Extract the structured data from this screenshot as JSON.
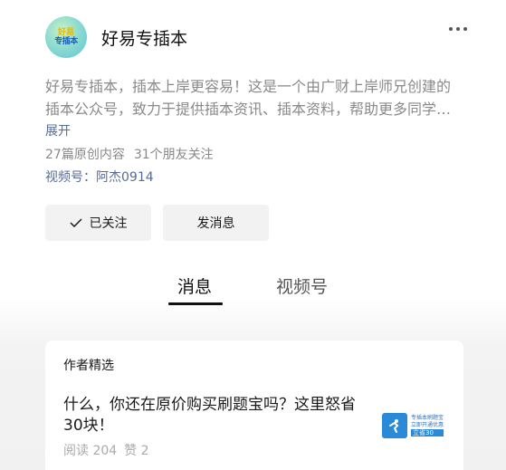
{
  "account": {
    "avatar_line1": "好易",
    "avatar_line2": "专插本",
    "name": "好易专插本",
    "description": "好易专插本，插本上岸更容易！这是一个由广财上岸师兄创建的插本公众号，致力于提供插本资讯、插本资料，帮助更多同学顺利上岸！",
    "expand_label": "展开",
    "original_count": "27篇原创内容",
    "friends_following": "31个朋友关注",
    "channel": "视频号：阿杰0914"
  },
  "actions": {
    "follow_label": "已关注",
    "message_label": "发消息"
  },
  "tabs": [
    {
      "label": "消息",
      "active": true
    },
    {
      "label": "视频号",
      "active": false
    }
  ],
  "featured": {
    "section_title": "作者精选",
    "article_title": "什么，你还在原价购买刷题宝吗？这里怒省30块！",
    "reads": "阅读 204",
    "likes": "赞 2",
    "thumb_line1": "专插本刷题宝",
    "thumb_line2": "立即开通优惠",
    "thumb_line3": "立省30"
  }
}
